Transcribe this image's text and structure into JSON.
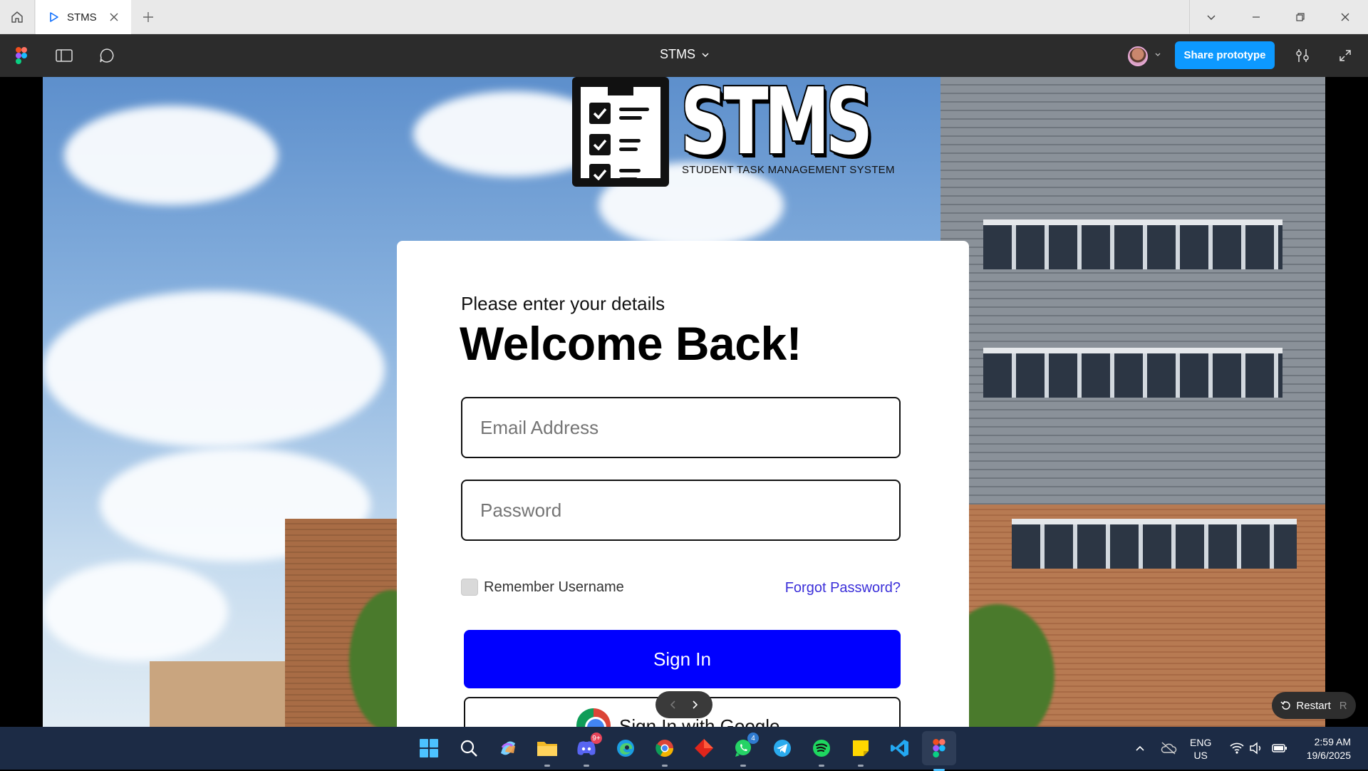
{
  "window": {
    "tab_title": "STMS",
    "colors": {
      "titlebar": "#e9e9e9",
      "toolbar": "#2c2c2c",
      "taskbar": "#1c2b45"
    }
  },
  "figma": {
    "file_title": "STMS",
    "share_label": "Share prototype",
    "share_color": "#0d99ff",
    "restart_label": "Restart",
    "restart_shortcut": "R"
  },
  "logo": {
    "word": "STMS",
    "tagline": "STUDENT TASK MANAGEMENT SYSTEM"
  },
  "login": {
    "subtitle": "Please enter your details",
    "heading": "Welcome Back!",
    "email_placeholder": "Email Address",
    "password_placeholder": "Password",
    "remember_label": "Remember Username",
    "remember_checked": false,
    "forgot_label": "Forgot Password?",
    "signin_label": "Sign In",
    "google_label": "Sign In with Google",
    "colors": {
      "primary_button": "#0000ff",
      "link": "#3b2fd9"
    }
  },
  "taskbar": {
    "apps": [
      {
        "name": "start-icon"
      },
      {
        "name": "search-icon"
      },
      {
        "name": "copilot-icon"
      },
      {
        "name": "file-explorer-icon"
      },
      {
        "name": "discord-icon",
        "badge": "9+"
      },
      {
        "name": "edge-icon"
      },
      {
        "name": "chrome-icon"
      },
      {
        "name": "app-red-diamond-icon"
      },
      {
        "name": "whatsapp-icon",
        "badge": "4"
      },
      {
        "name": "telegram-icon"
      },
      {
        "name": "spotify-icon"
      },
      {
        "name": "sticky-notes-icon"
      },
      {
        "name": "vscode-icon"
      },
      {
        "name": "figma-icon",
        "active": true
      }
    ],
    "language": "ENG",
    "region": "US",
    "time": "2:59 AM",
    "date": "19/6/2025"
  }
}
